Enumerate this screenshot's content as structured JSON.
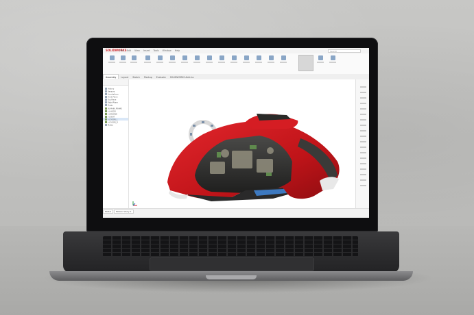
{
  "app": {
    "logo_text": "SOLIDWORKS",
    "menu": [
      "File",
      "Edit",
      "View",
      "Insert",
      "Tools",
      "Window",
      "Help"
    ],
    "search_placeholder": "Search"
  },
  "tabs": [
    "Assembly",
    "Layout",
    "Sketch",
    "Markup",
    "Evaluate",
    "SOLIDWORKS Add-Ins"
  ],
  "tree": {
    "items": [
      "History",
      "Sensors",
      "Annotations",
      "Front Plane",
      "Top Plane",
      "Right Plane",
      "Origin",
      "(f) MAIN_FRAME",
      "(-) HOOD",
      "(-) ENGINE",
      "(-) SEAT",
      "(-) DOOR_L",
      "(-) DOOR_R",
      "Mates"
    ]
  },
  "model_tabs": [
    "Model",
    "Motion Study 1"
  ],
  "colors": {
    "accent": "#d0262b",
    "body_red": "#c8151b",
    "ribbon_icon": "#8aa6c6"
  },
  "icons": [
    "search-icon",
    "view-orientation-wheel-icon",
    "triad-icon"
  ]
}
